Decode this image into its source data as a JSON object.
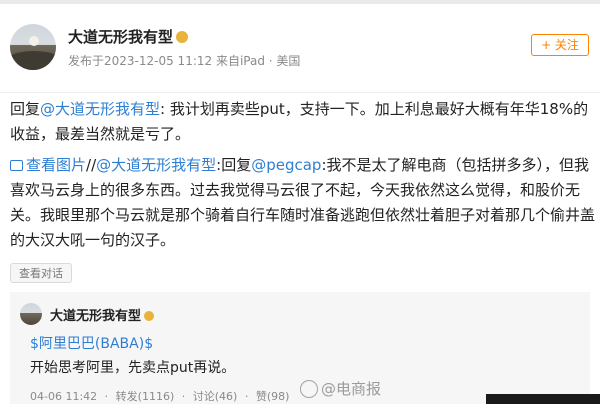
{
  "post": {
    "author": "大道无形我有型",
    "meta": "发布于2023-12-05 11:12  来自iPad  · 美国",
    "follow_label": "+ 关注",
    "reply_prefix": "回复",
    "reply_mention": "@大道无形我有型",
    "reply_text": ": 我计划再卖些put，支持一下。加上利息最好大概有年华18%的收益，最差当然就是亏了。",
    "view_image_label": "查看图片",
    "repost_sep": "//",
    "repost_mention": "@大道无形我有型",
    "repost_reply_prefix": ":回复",
    "repost_mention2": "@pegcap",
    "repost_text": ":我不是太了解电商（包括拼多多），但我喜欢马云身上的很多东西。过去我觉得马云很了不起，今天我依然这么觉得，和股价无关。我眼里那个马云就是那个骑着自行车随时准备逃跑但依然壮着胆子对着那几个偷井盖的大汉大吼一句的汉子。",
    "view_conversation_label": "查看对话"
  },
  "quoted": {
    "author": "大道无形我有型",
    "topic": "$阿里巴巴(BABA)$",
    "text": "开始思考阿里，先卖点put再说。",
    "time": "04-06 11:42",
    "repost": "转发(1116)",
    "comment": "讨论(46)",
    "like": "赞(98)"
  },
  "watermark": "@电商报",
  "colors": {
    "link": "#2e7fd4",
    "follow": "#ff8200",
    "vip_badge": "#e9b23a"
  },
  "icons": [
    "image-icon",
    "vip-badge-icon",
    "weibo-logo-icon"
  ]
}
